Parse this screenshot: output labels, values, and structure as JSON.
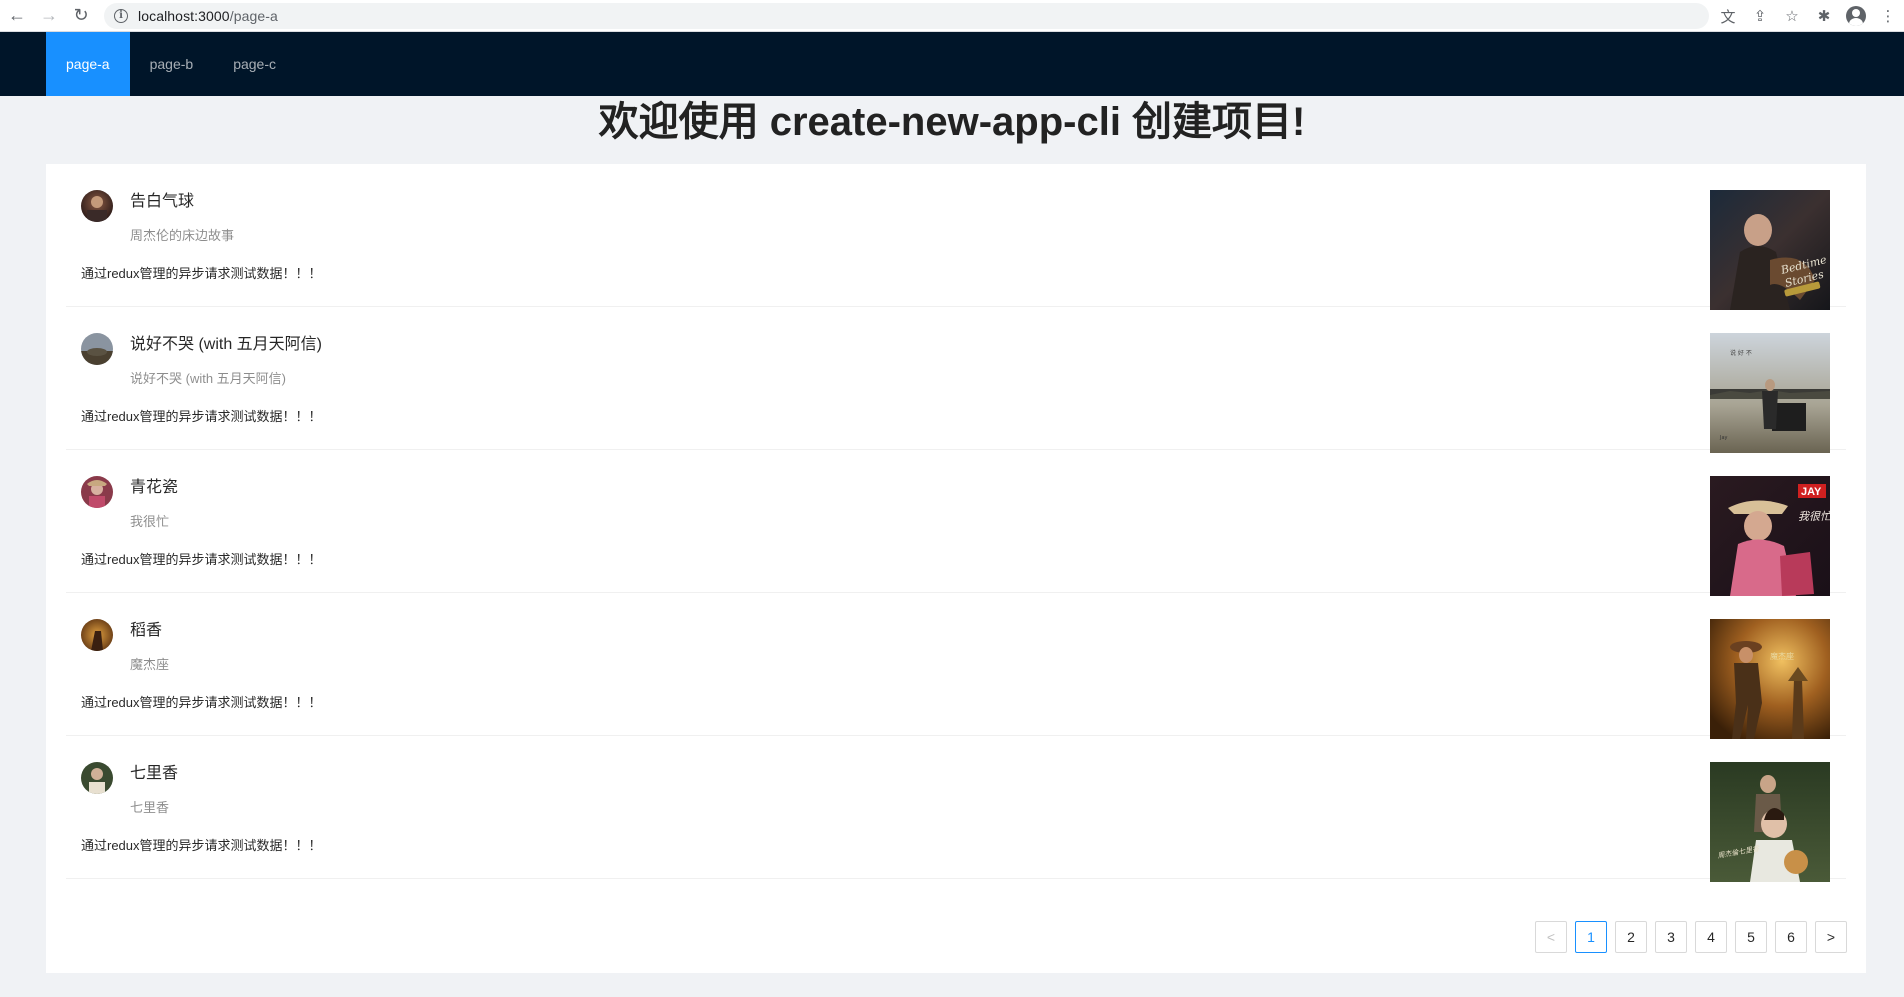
{
  "browser": {
    "url_host": "localhost:3000",
    "url_path": "/page-a",
    "back_icon": "←",
    "forward_icon": "→",
    "reload_icon": "↻",
    "info_icon": "i",
    "translate_icon": "文",
    "share_icon": "⇪",
    "star_icon": "☆",
    "extensions_icon": "✱",
    "menu_icon": "⋮"
  },
  "header": {
    "menu": [
      {
        "label": "page-a",
        "active": true
      },
      {
        "label": "page-b",
        "active": false
      },
      {
        "label": "page-c",
        "active": false
      }
    ],
    "background": "#001529",
    "active_color": "#1890ff"
  },
  "title": "欢迎使用 create-new-app-cli 创建项目!",
  "list": {
    "items": [
      {
        "title": "告白气球",
        "description": "周杰伦的床边故事",
        "content": "通过redux管理的异步请求测试数据！！！"
      },
      {
        "title": "说好不哭 (with 五月天阿信)",
        "description": "说好不哭 (with 五月天阿信)",
        "content": "通过redux管理的异步请求测试数据！！！"
      },
      {
        "title": "青花瓷",
        "description": "我很忙",
        "content": "通过redux管理的异步请求测试数据！！！"
      },
      {
        "title": "稻香",
        "description": "魔杰座",
        "content": "通过redux管理的异步请求测试数据！！！"
      },
      {
        "title": "七里香",
        "description": "七里香",
        "content": "通过redux管理的异步请求测试数据！！！"
      }
    ]
  },
  "pagination": {
    "prev_icon": "<",
    "next_icon": ">",
    "pages": [
      "1",
      "2",
      "3",
      "4",
      "5",
      "6"
    ],
    "current": "1"
  }
}
